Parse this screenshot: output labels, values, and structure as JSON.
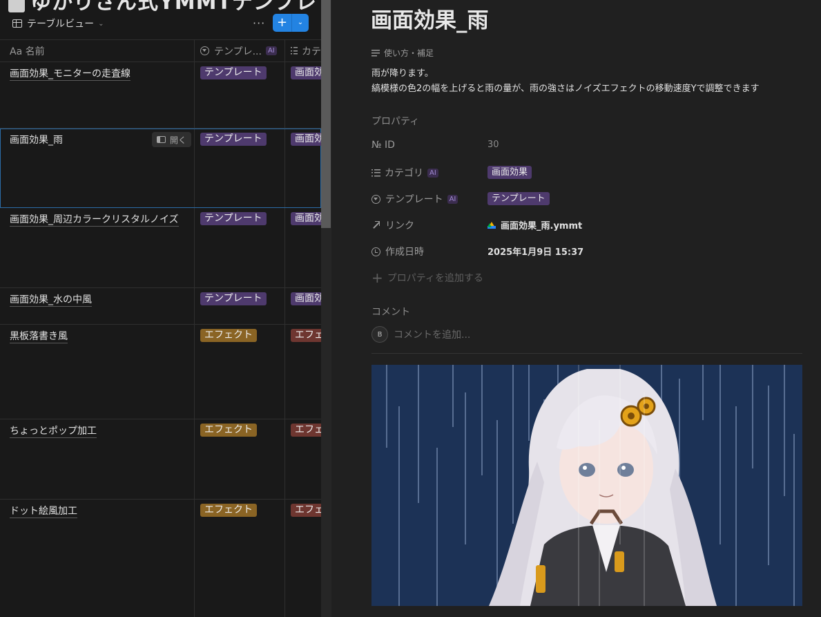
{
  "window": {
    "top_title": "ゆかりさん式YMMTテンプレ"
  },
  "toolbar": {
    "view_label": "テーブルビュー",
    "more_label": "···",
    "new_label": "+"
  },
  "table": {
    "columns": [
      {
        "icon": "text-icon",
        "label": "Aa 名前"
      },
      {
        "icon": "select-icon",
        "label": "テンプレ..."
      },
      {
        "icon": "list-icon",
        "label": "カテ"
      }
    ],
    "open_label": "開く",
    "rows": [
      {
        "name": "画面効果_モニターの走査線",
        "tag": "テンプレート",
        "category": "画面効果"
      },
      {
        "name": "画面効果_雨",
        "tag": "テンプレート",
        "category": "画面効果"
      },
      {
        "name": "画面効果_周辺カラークリスタルノイズ",
        "tag": "テンプレート",
        "category": "画面効果"
      },
      {
        "name": "画面効果_水の中風",
        "tag": "テンプレート",
        "category": "画面効果"
      },
      {
        "name": "黒板落書き風",
        "tag": "エフェクト",
        "category": "エフェクト"
      },
      {
        "name": "ちょっとポップ加工",
        "tag": "エフェクト",
        "category": "エフェクト"
      },
      {
        "name": "ドット絵風加工",
        "tag": "エフェクト",
        "category": "エフェクト"
      }
    ]
  },
  "detail": {
    "title": "画面効果_雨",
    "usage_label": "使い方・補足",
    "description_line1": "雨が降ります。",
    "description_line2": "縞模様の色2の幅を上げると雨の量が、雨の強さはノイズエフェクトの移動速度Yで調整できます",
    "properties_label": "プロパティ",
    "props": {
      "id_label": "№ ID",
      "id_value": "30",
      "category_label": "カテゴリ",
      "category_value": "画面効果",
      "template_label": "テンプレート",
      "template_value": "テンプレート",
      "link_label": "リンク",
      "link_value": "画面効果_雨.ymmt",
      "created_label": "作成日時",
      "created_value": "2025年1月9日 15:37",
      "ai_badge": "AI"
    },
    "add_property_label": "プロパティを追加する",
    "comment_label": "コメント",
    "comment_avatar": "B",
    "comment_placeholder": "コメントを追加..."
  },
  "colors": {
    "tag_template": "#4e3a6d",
    "tag_effect": "#8a6424",
    "tag_category_effect": "#6e3630",
    "accent": "#2383e2",
    "rain_bg": "#1c3256"
  }
}
